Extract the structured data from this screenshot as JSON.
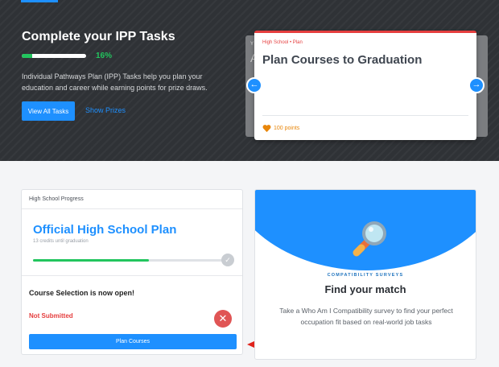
{
  "hero": {
    "title": "Complete your IPP Tasks",
    "progress_percent": 16,
    "progress_label": "16%",
    "description": "Individual Pathways Plan (IPP) Tasks help you plan your education and career while earning points for prize draws.",
    "view_all_label": "View All Tasks",
    "show_prizes_label": "Show Prizes",
    "peek_letters": [
      "Y",
      "A"
    ]
  },
  "task_card": {
    "category": "High School • Plan",
    "title": "Plan Courses to Graduation",
    "points": "100 points"
  },
  "hs_card": {
    "header": "High School Progress",
    "title": "Official High School Plan",
    "subtitle": "13 credits until graduation",
    "progress_fraction": 0.6,
    "open_notice": "Course Selection is now open!",
    "status": "Not Submitted",
    "plan_button": "Plan Courses"
  },
  "survey_card": {
    "kicker": "COMPATIBILITY SURVEYS",
    "title": "Find your match",
    "description": "Take a Who Am I Compatibility survey to find your perfect occupation fit based on real-world job tasks"
  },
  "colors": {
    "accent": "#1e90ff",
    "success": "#22c55e",
    "danger": "#e53e3e",
    "points": "#e8860b"
  },
  "icons": [
    "chevron-left-icon",
    "chevron-right-icon",
    "heart-icon",
    "check-icon",
    "close-icon",
    "magnifier-icon"
  ]
}
